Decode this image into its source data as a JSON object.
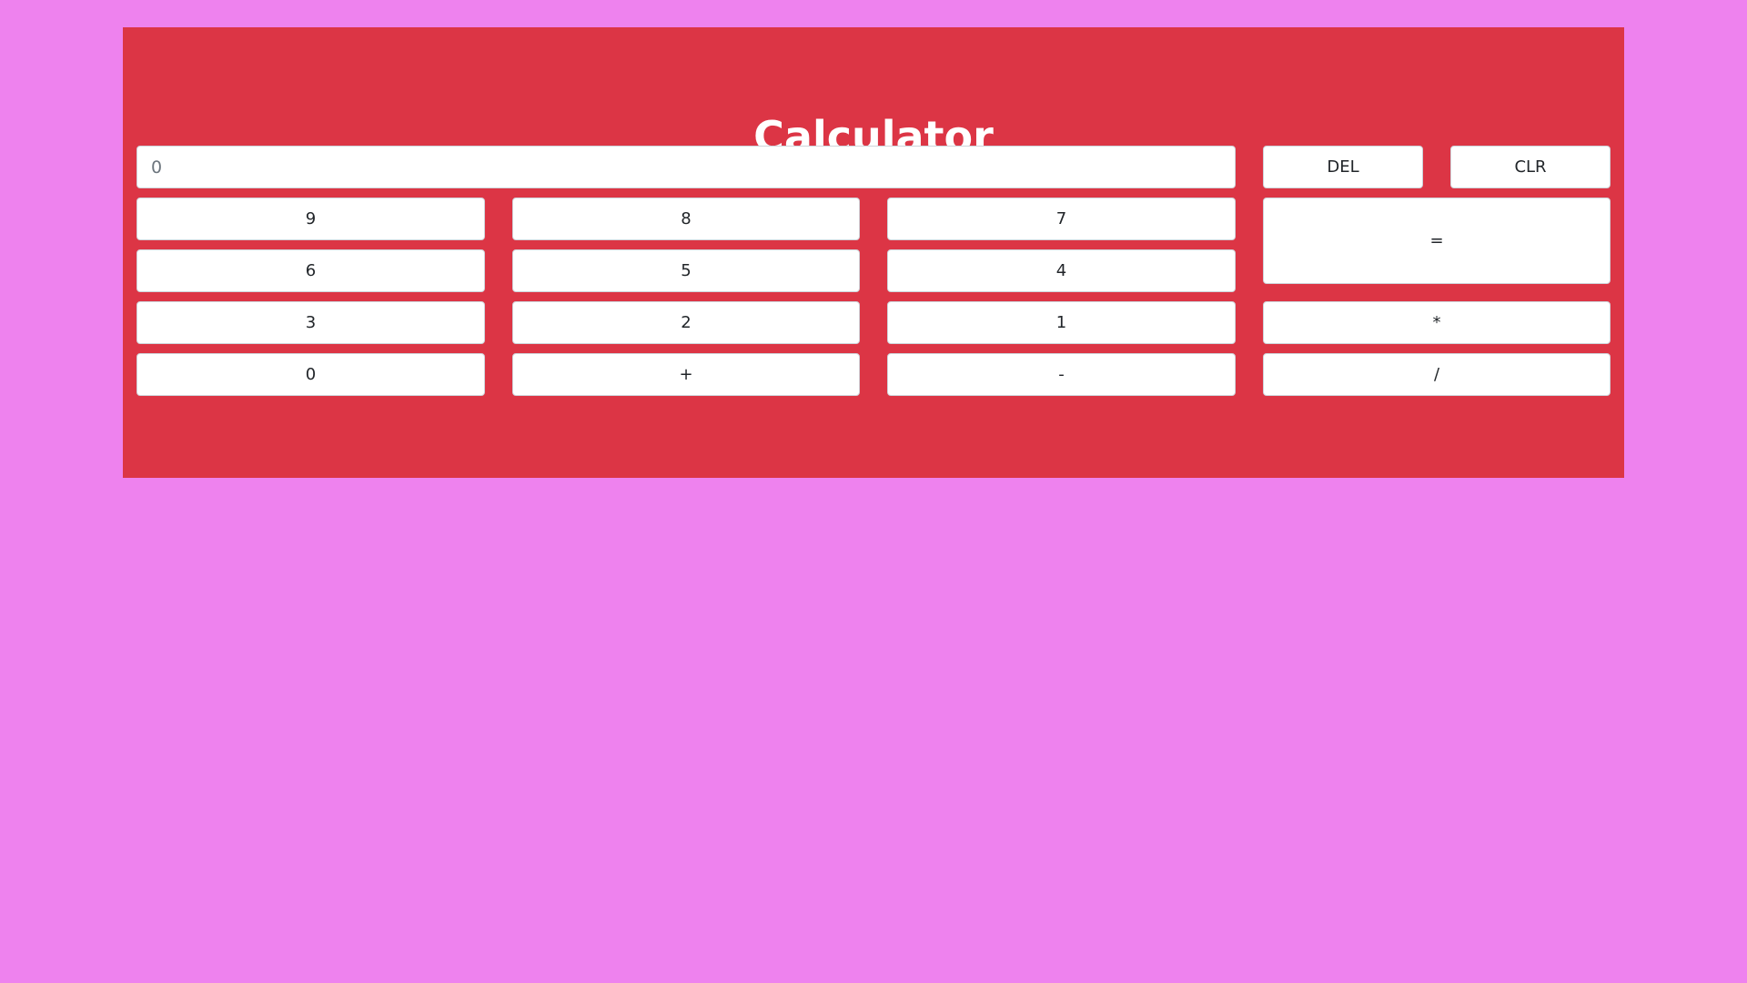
{
  "app": {
    "title": "Calculator"
  },
  "display": {
    "placeholder": "0",
    "value": ""
  },
  "buttons": {
    "del": "DEL",
    "clr": "CLR",
    "nine": "9",
    "eight": "8",
    "seven": "7",
    "six": "6",
    "five": "5",
    "four": "4",
    "three": "3",
    "two": "2",
    "one": "1",
    "zero": "0",
    "plus": "+",
    "minus": "-",
    "equals": "=",
    "multiply": "*",
    "divide": "/"
  },
  "colors": {
    "page_background": "#ee82ee",
    "panel_background": "#dc3545",
    "button_background": "#ffffff",
    "title_text": "#ffffff"
  }
}
